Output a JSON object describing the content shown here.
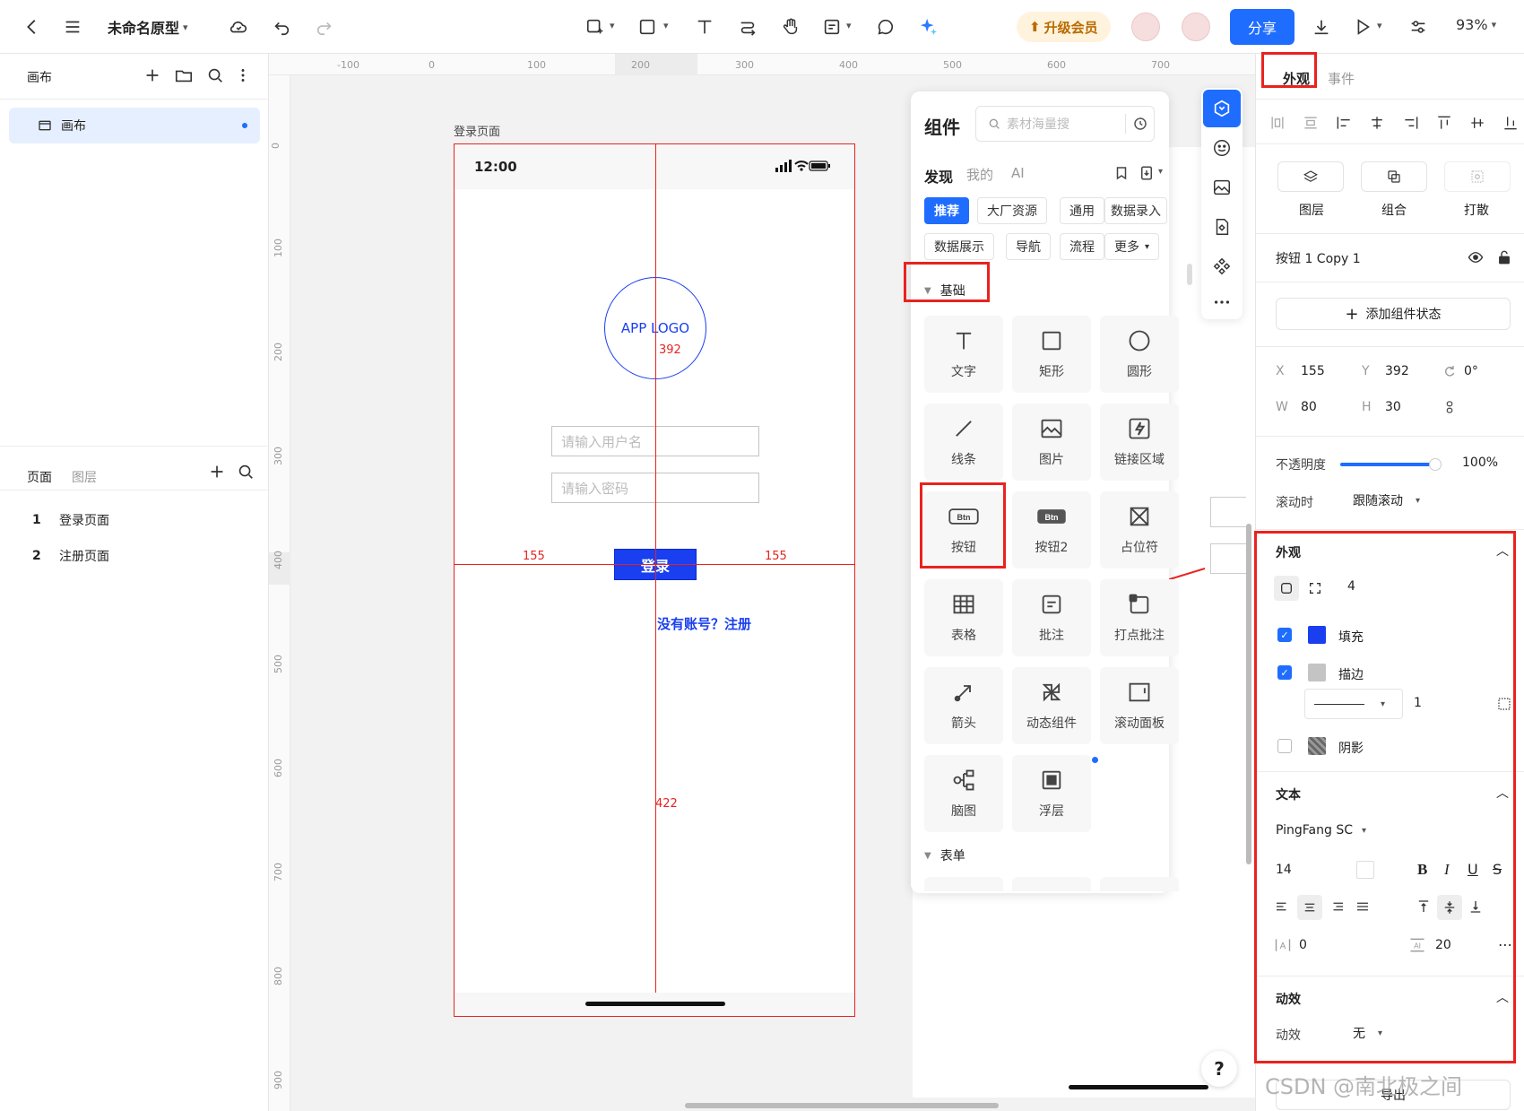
{
  "topbar": {
    "title": "未命名原型",
    "upgrade_label": "升级会员",
    "share_label": "分享",
    "zoom": "93%"
  },
  "left_panel": {
    "canvas_header": "画布",
    "canvas_item": "画布",
    "tabs": [
      "页面",
      "图层"
    ],
    "pages": [
      {
        "num": "1",
        "name": "登录页面"
      },
      {
        "num": "2",
        "name": "注册页面"
      }
    ]
  },
  "ruler": {
    "top_ticks": [
      "-100",
      "0",
      "100",
      "200",
      "300",
      "400",
      "500",
      "600",
      "700"
    ],
    "left_ticks": [
      "0",
      "100",
      "200",
      "300",
      "400",
      "500",
      "600",
      "700",
      "800",
      "900"
    ]
  },
  "artboard": {
    "label": "登录页面",
    "status_time": "12:00",
    "logo_text": "APP LOGO",
    "username_placeholder": "请输入用户名",
    "password_placeholder": "请输入密码",
    "login_button": "登录",
    "register_link": "没有账号？注册",
    "measure_top": "392",
    "measure_left": "155",
    "measure_right": "155",
    "measure_bottom": "422"
  },
  "component_panel": {
    "title": "组件",
    "search_placeholder": "素材海量搜",
    "tabs": [
      "发现",
      "我的",
      "AI"
    ],
    "categories": [
      "推荐",
      "大厂资源",
      "通用",
      "数据录入",
      "数据展示",
      "导航",
      "流程",
      "更多"
    ],
    "section_basic": "基础",
    "section_form": "表单",
    "items": [
      "文字",
      "矩形",
      "圆形",
      "线条",
      "图片",
      "链接区域",
      "按钮",
      "按钮2",
      "占位符",
      "表格",
      "批注",
      "打点批注",
      "箭头",
      "动态组件",
      "滚动面板",
      "脑图",
      "浮层"
    ]
  },
  "right_panel": {
    "tabs": [
      "外观",
      "事件"
    ],
    "layer_actions": [
      "图层",
      "组合",
      "打散"
    ],
    "element_name": "按钮 1 Copy 1",
    "add_state": "添加组件状态",
    "x_label": "X",
    "x_value": "155",
    "y_label": "Y",
    "y_value": "392",
    "rotation": "0°",
    "w_label": "W",
    "w_value": "80",
    "h_label": "H",
    "h_value": "30",
    "opacity_label": "不透明度",
    "opacity": 1.0,
    "opacity_value": "100%",
    "scroll_label": "滚动时",
    "scroll_value": "跟随滚动",
    "appearance_title": "外观",
    "radius_value": "4",
    "fill_label": "填充",
    "fill_color": "#1a3ff0",
    "stroke_label": "描边",
    "stroke_color": "#c4c4c4",
    "stroke_width": "1",
    "shadow_label": "阴影",
    "text_title": "文本",
    "font_name": "PingFang SC",
    "font_size": "14",
    "letter_spacing": "0",
    "line_height": "20",
    "animation_title": "动效",
    "animation_label": "动效",
    "animation_value": "无",
    "export_label": "导出"
  },
  "watermark": "CSDN @南北极之间",
  "help": "?",
  "colors": {
    "accent": "#1f6dff",
    "button_blue": "#1a3ff0",
    "annotation_red": "#e8231f"
  }
}
